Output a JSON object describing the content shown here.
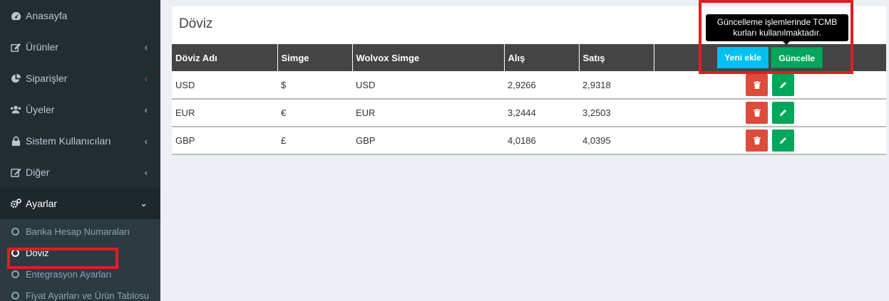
{
  "sidebar": {
    "items": [
      {
        "label": "Anasayfa",
        "icon": "dashboard-icon"
      },
      {
        "label": "Ürünler",
        "icon": "edit-icon"
      },
      {
        "label": "Siparişler",
        "icon": "pie-chart-icon"
      },
      {
        "label": "Üyeler",
        "icon": "users-icon"
      },
      {
        "label": "Sistem Kullanıcıları",
        "icon": "lock-icon"
      },
      {
        "label": "Diğer",
        "icon": "pencil-square-icon"
      },
      {
        "label": "Ayarlar",
        "icon": "gears-icon"
      }
    ],
    "submenu": [
      {
        "label": "Banka Hesap Numaraları"
      },
      {
        "label": "Döviz"
      },
      {
        "label": "Entegrasyon Ayarları"
      },
      {
        "label": "Fiyat Ayarları ve Ürün Tablosu"
      }
    ]
  },
  "main": {
    "title": "Döviz",
    "table": {
      "headers": [
        "Döviz Adı",
        "Simge",
        "Wolvox Simge",
        "Alış",
        "Satış"
      ],
      "rows": [
        [
          "USD",
          "$",
          "USD",
          "2,9266",
          "2,9318"
        ],
        [
          "EUR",
          "€",
          "EUR",
          "3,2444",
          "3,2503"
        ],
        [
          "GBP",
          "£",
          "GBP",
          "4,0186",
          "4,0395"
        ]
      ]
    },
    "buttons": {
      "add": "Yeni ekle",
      "update": "Güncelle"
    },
    "tooltip": "Güncelleme işlemlerinde TCMB kurları kullanılmaktadır."
  },
  "colors": {
    "sidebar_bg": "#222d32",
    "danger": "#dd4b39",
    "success": "#00a65a",
    "info": "#00c0ef",
    "highlight": "#dd1f26"
  }
}
